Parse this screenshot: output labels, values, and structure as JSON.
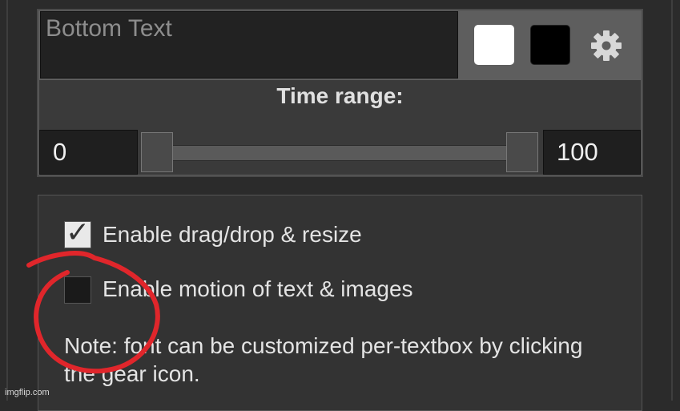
{
  "textbox": {
    "placeholder": "Bottom Text",
    "color_primary": "#ffffff",
    "color_secondary": "#000000",
    "settings_icon": "gear-icon"
  },
  "time_range": {
    "label": "Time range:",
    "start": "0",
    "end": "100"
  },
  "options": {
    "drag_resize": {
      "label": "Enable drag/drop & resize",
      "checked": true
    },
    "motion": {
      "label": "Enable motion of text & images",
      "checked": false
    },
    "note": "Note: font can be customized per-textbox by clicking the gear icon."
  },
  "watermark": "imgflip.com",
  "annotation_color": "#e0262b"
}
